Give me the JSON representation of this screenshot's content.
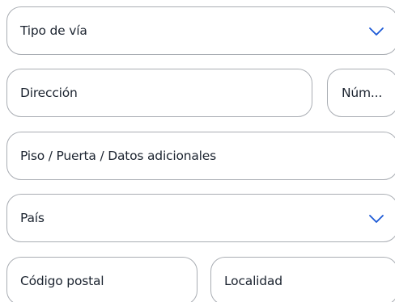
{
  "form": {
    "street_type": {
      "placeholder": "Tipo de vía",
      "icon": "chevron-down-icon"
    },
    "address": {
      "placeholder": "Dirección"
    },
    "number": {
      "placeholder": "Núm..."
    },
    "additional": {
      "placeholder": "Piso / Puerta / Datos adicionales"
    },
    "country": {
      "placeholder": "País",
      "icon": "chevron-down-icon"
    },
    "postal_code": {
      "placeholder": "Código postal"
    },
    "locality": {
      "placeholder": "Localidad"
    }
  },
  "colors": {
    "border": "#a9adb3",
    "text": "#1c2430",
    "chevron": "#1b59d6",
    "background": "#ffffff"
  }
}
